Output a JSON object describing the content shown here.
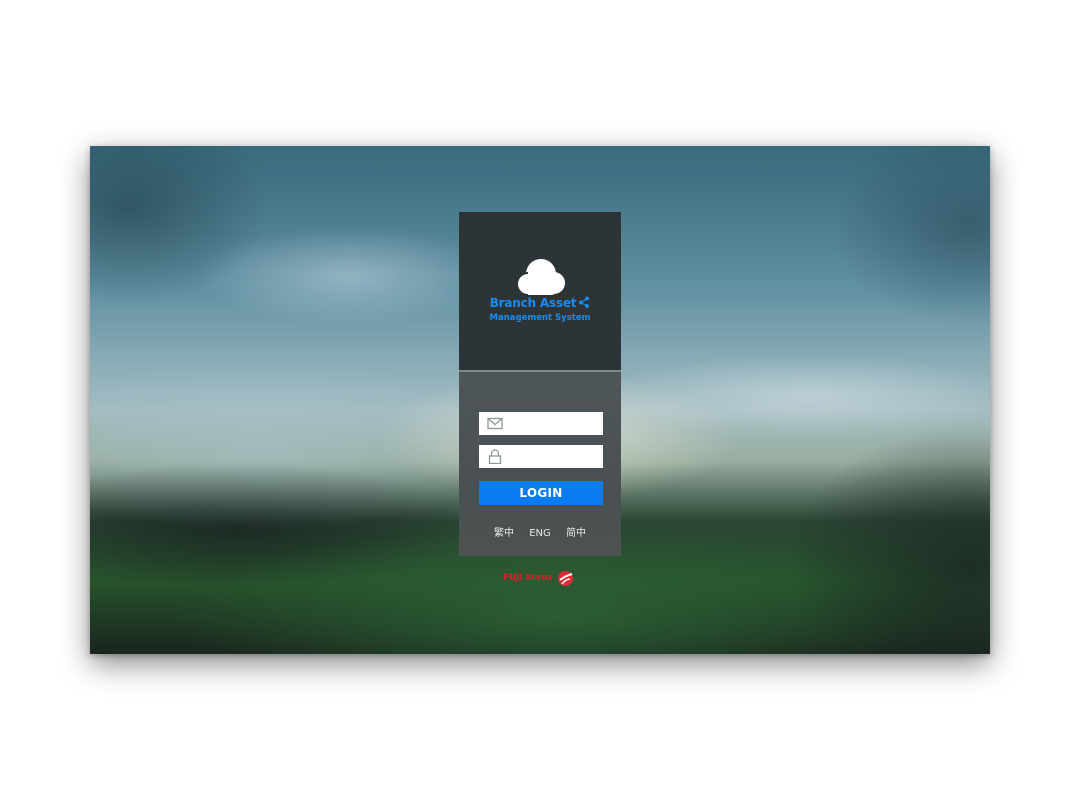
{
  "brand": {
    "line1": "Branch Asset",
    "line2": "Management System",
    "color": "#1a8cf0",
    "logo_icon": "cloud-icon",
    "share_icon": "share-icon"
  },
  "login_form": {
    "email": {
      "value": "",
      "icon": "envelope-icon"
    },
    "password": {
      "value": "",
      "icon": "lock-icon"
    },
    "login_label": "LOGIN",
    "login_color": "#0a7cf2"
  },
  "languages": [
    "繁中",
    "ENG",
    "简中"
  ],
  "vendor": {
    "text": "FUJI Xerox",
    "icon": "fuji-xerox-logo-icon",
    "color": "#d6202a"
  }
}
